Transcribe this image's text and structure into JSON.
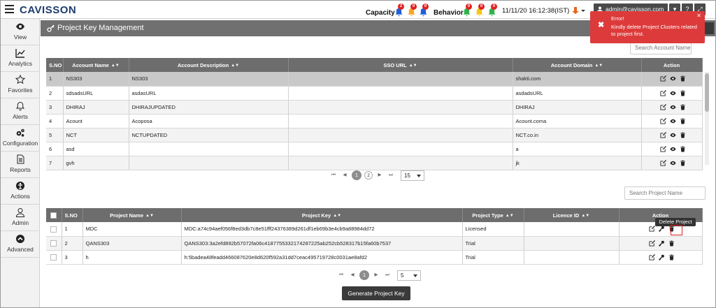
{
  "app": {
    "logo": "CAVISSON"
  },
  "topbar": {
    "capacity_label": "Capacity",
    "behavior_label": "Behavior",
    "capacity_counts": [
      "2",
      "0",
      "0"
    ],
    "behavior_counts": [
      "0",
      "0",
      "0"
    ],
    "bell_colors_capacity": [
      "#1f5fd8",
      "#f5a623",
      "#1f5fd8"
    ],
    "bell_colors_behavior": [
      "#2fb24a",
      "#f5c518",
      "#2fb24a"
    ],
    "datetime": "11/11/20 16:12:38(IST)",
    "user": "admin@cavisson.com"
  },
  "sidebar": {
    "items": [
      {
        "label": "View",
        "icon": "eye-icon"
      },
      {
        "label": "Analytics",
        "icon": "chart-icon"
      },
      {
        "label": "Favorites",
        "icon": "star-icon"
      },
      {
        "label": "Alerts",
        "icon": "bell-icon"
      },
      {
        "label": "Configuration",
        "icon": "gears-icon"
      },
      {
        "label": "Reports",
        "icon": "report-icon"
      },
      {
        "label": "Actions",
        "icon": "actions-icon"
      },
      {
        "label": "Admin",
        "icon": "user-icon"
      },
      {
        "label": "Advanced",
        "icon": "advanced-icon"
      }
    ]
  },
  "page": {
    "title": "Project Key Management"
  },
  "account_search": {
    "placeholder": "Search Account Name"
  },
  "account_table": {
    "headers": [
      "S.NO",
      "Account Name",
      "Account Description",
      "SSO URL",
      "Account Domain",
      "Action"
    ],
    "rows": [
      [
        "1",
        "NS303",
        "NS303",
        "",
        "shakti.com"
      ],
      [
        "2",
        "sdsadsURL",
        "asdasURL",
        "",
        "asdadsURL"
      ],
      [
        "3",
        "DHIRAJ",
        "DHIRAJUPDATED",
        "",
        "DHIRAJ"
      ],
      [
        "4",
        "Acount",
        "Acoposa",
        "",
        "Acount.coma"
      ],
      [
        "5",
        "NCT",
        "NCTUPDATED",
        "",
        "NCT.co.in"
      ],
      [
        "6",
        "asd",
        "",
        "",
        "a"
      ],
      [
        "7",
        "gvh",
        "",
        "",
        "jk"
      ]
    ]
  },
  "account_pager": {
    "current": "1",
    "other": "2",
    "per_page": "15"
  },
  "project_search": {
    "placeholder": "Search Project Name"
  },
  "project_table": {
    "headers": [
      "S.NO",
      "Project Name",
      "Project Key",
      "Project Type",
      "Licence ID",
      "Action"
    ],
    "rows": [
      [
        "1",
        "MDC",
        "MDC:a74c94aef056f8ed3db7c8e51fff24376389d261df1eb69b3e4cb9a88984dd72",
        "Licensed",
        ""
      ],
      [
        "2",
        "QANS303",
        "QANS303:3a2efd892b57072fa06c418775533217428722​5ab252cb528317b15fa60b7537",
        "Trial",
        ""
      ],
      [
        "3",
        "h",
        "h:5badea48feadd466087620e8d620f592a31dd7ceac495719728c0031ae8afd2",
        "Trial",
        ""
      ]
    ]
  },
  "project_pager": {
    "current": "1",
    "per_page": "5"
  },
  "buttons": {
    "generate": "Generate Project Key"
  },
  "tooltip": {
    "text": "Delete Project"
  },
  "toast": {
    "title": "Error!",
    "message": "Kindly delete Project Clusters related to project first."
  }
}
